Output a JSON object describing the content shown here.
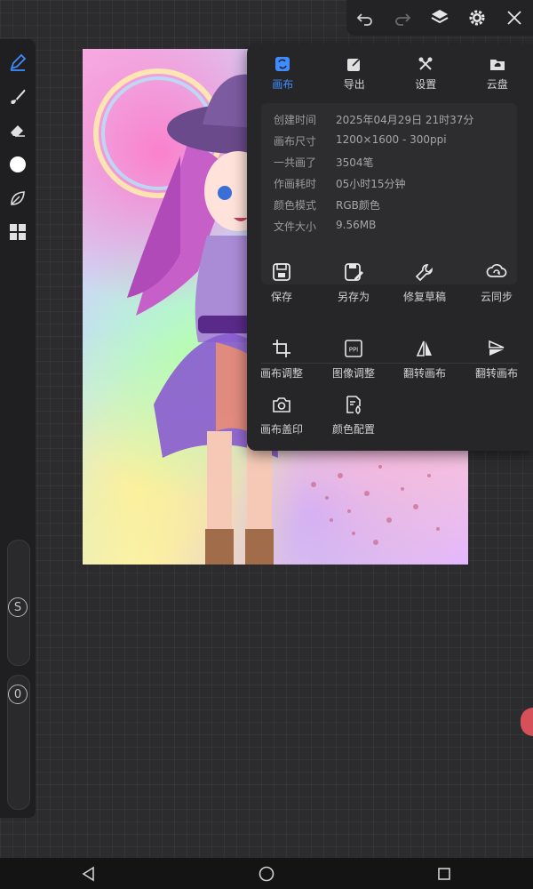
{
  "panel": {
    "tabs": [
      {
        "label": "画布",
        "icon": "canvas-icon",
        "active": true
      },
      {
        "label": "导出",
        "icon": "export-icon",
        "active": false
      },
      {
        "label": "设置",
        "icon": "settings-tools-icon",
        "active": false
      },
      {
        "label": "云盘",
        "icon": "cloud-folder-icon",
        "active": false
      }
    ],
    "info": [
      {
        "key": "创建时间",
        "value": "2025年04月29日 21时37分"
      },
      {
        "key": "画布尺寸",
        "value": "1200×1600 - 300ppi"
      },
      {
        "key": "一共画了",
        "value": "3504笔"
      },
      {
        "key": "作画耗时",
        "value": "05小时15分钟"
      },
      {
        "key": "颜色模式",
        "value": "RGB颜色"
      },
      {
        "key": "文件大小",
        "value": "9.56MB"
      }
    ],
    "actions_row1": [
      {
        "label": "保存",
        "icon": "save-icon"
      },
      {
        "label": "另存为",
        "icon": "save-as-icon"
      },
      {
        "label": "修复草稿",
        "icon": "repair-wrench-icon"
      },
      {
        "label": "云同步",
        "icon": "cloud-sync-icon"
      }
    ],
    "actions_row2": [
      {
        "label": "画布调整",
        "icon": "crop-icon"
      },
      {
        "label": "图像调整",
        "icon": "ppi-icon"
      },
      {
        "label": "翻转画布",
        "icon": "flip-horizontal-icon"
      },
      {
        "label": "翻转画布",
        "icon": "flip-vertical-icon"
      }
    ],
    "actions_row3": [
      {
        "label": "画布盖印",
        "icon": "camera-stamp-icon"
      },
      {
        "label": "颜色配置",
        "icon": "color-config-icon"
      }
    ]
  },
  "sliders": {
    "size_label": "S",
    "opacity_label": "0"
  },
  "colors": {
    "accent": "#3f8cff",
    "panel_bg": "#262628",
    "current_brush": "#ffffff"
  }
}
